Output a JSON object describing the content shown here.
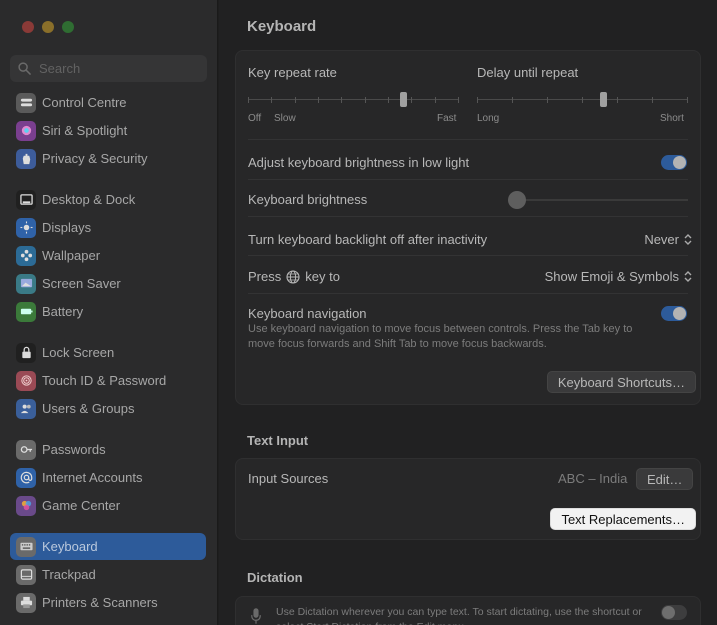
{
  "colors": {
    "accent": "#2d5b9a",
    "sidebar_bg": "#2b2b2c",
    "main_bg": "#212122",
    "highlight_button": "#f2f2f2"
  },
  "sidebar": {
    "search_placeholder": "Search",
    "items": [
      {
        "label": "Control Centre",
        "icon": "control-centre-icon",
        "color": "#5a5a5a"
      },
      {
        "label": "Siri & Spotlight",
        "icon": "siri-icon",
        "color": "#7a3f8f"
      },
      {
        "label": "Privacy & Security",
        "icon": "hand-icon",
        "color": "#3d5c9a"
      },
      {
        "label": "Desktop & Dock",
        "icon": "dock-icon",
        "color": "#202020"
      },
      {
        "label": "Displays",
        "icon": "displays-icon",
        "color": "#2f62a8"
      },
      {
        "label": "Wallpaper",
        "icon": "wallpaper-icon",
        "color": "#2c6b96"
      },
      {
        "label": "Screen Saver",
        "icon": "screen-saver-icon",
        "color": "#3a7a86"
      },
      {
        "label": "Battery",
        "icon": "battery-icon",
        "color": "#3b7a3a"
      },
      {
        "label": "Lock Screen",
        "icon": "lock-icon",
        "color": "#202020"
      },
      {
        "label": "Touch ID & Password",
        "icon": "fingerprint-icon",
        "color": "#9a4a55"
      },
      {
        "label": "Users & Groups",
        "icon": "users-icon",
        "color": "#3a5f9a"
      },
      {
        "label": "Passwords",
        "icon": "key-icon",
        "color": "#6a6a6a"
      },
      {
        "label": "Internet Accounts",
        "icon": "at-icon",
        "color": "#2f62a8"
      },
      {
        "label": "Game Center",
        "icon": "game-center-icon",
        "color": "#6a4a8a"
      },
      {
        "label": "Keyboard",
        "icon": "keyboard-icon",
        "color": "#6a6a6a",
        "active": true
      },
      {
        "label": "Trackpad",
        "icon": "trackpad-icon",
        "color": "#6a6a6a"
      },
      {
        "label": "Printers & Scanners",
        "icon": "printer-icon",
        "color": "#6a6a6a"
      }
    ]
  },
  "main": {
    "title": "Keyboard",
    "key_repeat": {
      "label": "Key repeat rate",
      "min_label": "Off",
      "slow_label": "Slow",
      "max_label": "Fast",
      "level": 0.74
    },
    "delay_repeat": {
      "label": "Delay until repeat",
      "min_label": "Long",
      "max_label": "Short",
      "level": 0.6
    },
    "adjust_brightness": {
      "label": "Adjust keyboard brightness in low light",
      "on": true
    },
    "keyboard_brightness": {
      "label": "Keyboard brightness",
      "level": 0.0
    },
    "backlight_off": {
      "label": "Turn keyboard backlight off after inactivity",
      "value": "Never"
    },
    "press_key": {
      "label_before": "Press",
      "label_after": "key to",
      "value": "Show Emoji & Symbols"
    },
    "keyboard_navigation": {
      "label": "Keyboard navigation",
      "description": "Use keyboard navigation to move focus between controls. Press the Tab key to move focus forwards and Shift Tab to move focus backwards.",
      "on": true
    },
    "shortcuts_button": "Keyboard Shortcuts…",
    "text_input": {
      "section_title": "Text Input",
      "input_sources_label": "Input Sources",
      "input_sources_value": "ABC – India",
      "edit_button": "Edit…",
      "text_replacements_button": "Text Replacements…"
    },
    "dictation": {
      "section_title": "Dictation",
      "description": "Use Dictation wherever you can type text. To start dictating, use the shortcut or select Start Dictation from the Edit menu.",
      "on": false
    }
  }
}
